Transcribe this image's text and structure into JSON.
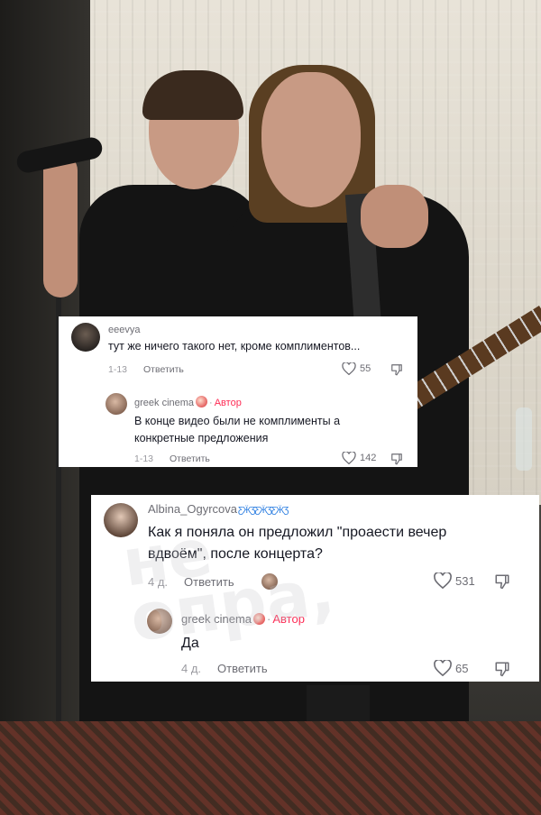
{
  "comments": {
    "c1": {
      "username": "eeevya",
      "text": "тут же ничего такого нет, кроме комплиментов...",
      "date": "1-13",
      "reply_label": "Ответить",
      "likes": "55"
    },
    "c1_reply": {
      "username": "greek cinema",
      "author_tag": "Автор",
      "text_line1": "В конце видео были не комплименты а",
      "text_line2": "конкретные предложения",
      "date": "1-13",
      "reply_label": "Ответить",
      "likes": "142"
    },
    "c2": {
      "username": "Albina_Ogyrcova",
      "text_line1": "Как я поняла он предложил \"проаести вечер",
      "text_line2": "вдвоём\", после концерта?",
      "date": "4 д.",
      "reply_label": "Ответить",
      "likes": "531"
    },
    "c2_reply": {
      "username": "greek cinema",
      "author_tag": "Автор",
      "text": "Да",
      "date": "4 д.",
      "reply_label": "Ответить",
      "likes": "65"
    }
  },
  "watermark": {
    "line1": "не",
    "line2": "опра,"
  },
  "icons": {
    "heart": "heart-outline-icon",
    "dislike": "thumb-down-icon",
    "badge": "butterfly-emoji"
  },
  "colors": {
    "author_tag": "#fe2c55",
    "meta": "#9a9aa0",
    "text": "#161823"
  }
}
